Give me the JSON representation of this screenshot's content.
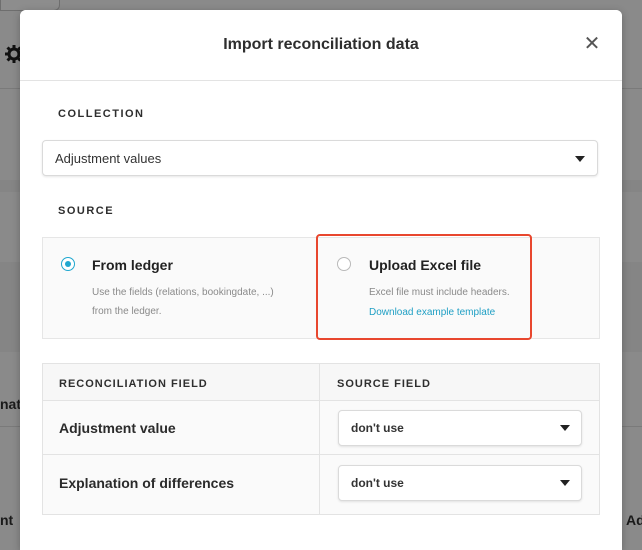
{
  "modal": {
    "title": "Import reconciliation data",
    "close_label": "✕"
  },
  "collection": {
    "label": "COLLECTION",
    "selected": "Adjustment values"
  },
  "source": {
    "label": "SOURCE",
    "options": [
      {
        "title": "From ledger",
        "description_lines": [
          "Use the fields (relations, bookingdate, ...)",
          "from the ledger."
        ],
        "selected": true
      },
      {
        "title": "Upload Excel file",
        "description_lines": [
          "Excel file must include headers."
        ],
        "link": "Download example template",
        "selected": false
      }
    ]
  },
  "mapping": {
    "columns": [
      "RECONCILIATION FIELD",
      "SOURCE FIELD"
    ],
    "rows": [
      {
        "field": "Adjustment value",
        "source": "don't use"
      },
      {
        "field": "Explanation of differences",
        "source": "don't use"
      }
    ]
  },
  "background": {
    "left_text_1": "nati",
    "left_text_2": "nt",
    "right_text": "Ad"
  },
  "colors": {
    "accent": "#1fa7cf",
    "highlight": "#e8472e",
    "link": "#1f9fc4"
  }
}
